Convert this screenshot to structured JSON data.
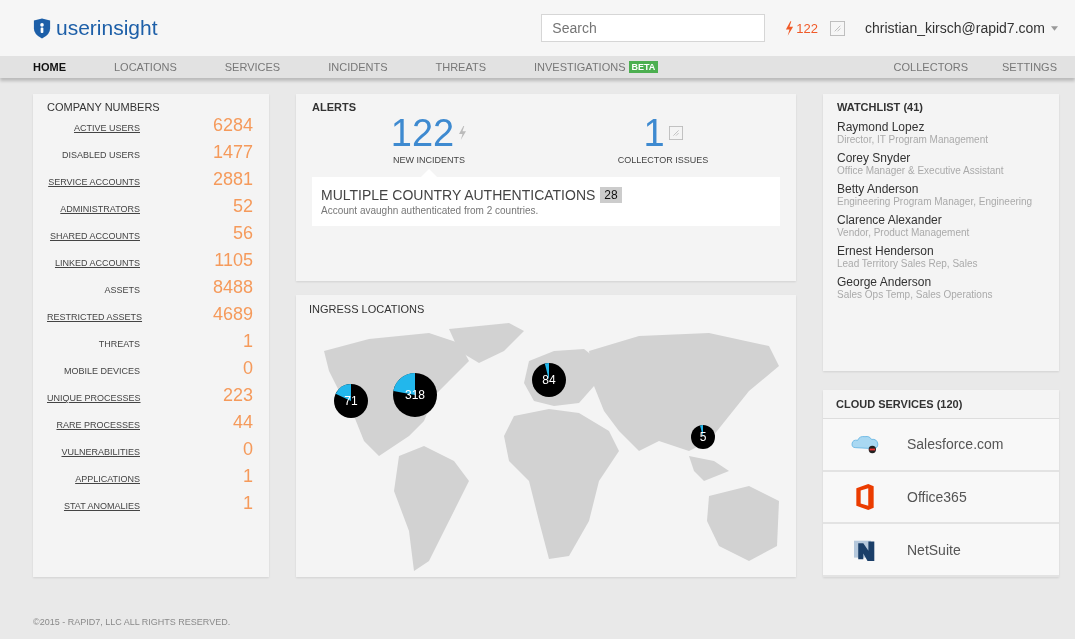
{
  "header": {
    "logo": "**user**insight",
    "search": {
      "placeholder": "Search"
    },
    "incident_count": "122",
    "user": "christian_kirsch@rapid7.com"
  },
  "nav": {
    "left": [
      {
        "label": "HOME",
        "selected": true
      },
      {
        "label": "LOCATIONS",
        "selected": false
      },
      {
        "label": "SERVICES",
        "selected": false
      },
      {
        "label": "INCIDENTS",
        "selected": false
      },
      {
        "label": "THREATS",
        "selected": false
      },
      {
        "label": "INVESTIGATIONS",
        "selected": false,
        "badge": "BETA"
      }
    ],
    "right": [
      {
        "label": "COLLECTORS",
        "selected": false
      },
      {
        "label": "SETTINGS",
        "selected": false
      }
    ]
  },
  "company_numbers": {
    "title": "COMPANY NUMBERS",
    "rows": [
      {
        "label": "ACTIVE USERS",
        "value": "6284",
        "link": true
      },
      {
        "label": "DISABLED USERS",
        "value": "1477",
        "link": false
      },
      {
        "label": "SERVICE ACCOUNTS",
        "value": "2881",
        "link": true
      },
      {
        "label": "ADMINISTRATORS",
        "value": "52",
        "link": true
      },
      {
        "label": "SHARED ACCOUNTS",
        "value": "56",
        "link": true
      },
      {
        "label": "LINKED ACCOUNTS",
        "value": "1105",
        "link": true
      },
      {
        "label": "ASSETS",
        "value": "8488",
        "link": false
      },
      {
        "label": "RESTRICTED ASSETS",
        "value": "4689",
        "link": true
      },
      {
        "label": "THREATS",
        "value": "1",
        "link": false
      },
      {
        "label": "MOBILE DEVICES",
        "value": "0",
        "link": false
      },
      {
        "label": "UNIQUE PROCESSES",
        "value": "223",
        "link": true
      },
      {
        "label": "RARE PROCESSES",
        "value": "44",
        "link": true
      },
      {
        "label": "VULNERABILITIES",
        "value": "0",
        "link": true
      },
      {
        "label": "APPLICATIONS",
        "value": "1",
        "link": true
      },
      {
        "label": "STAT ANOMALIES",
        "value": "1",
        "link": true
      }
    ]
  },
  "alerts": {
    "title": "ALERTS",
    "stats": [
      {
        "value": "122",
        "label": "NEW INCIDENTS",
        "selected": true,
        "kind": "incidents"
      },
      {
        "value": "1",
        "label": "COLLECTOR ISSUES",
        "selected": false,
        "kind": "collectors"
      }
    ],
    "detail": {
      "title": "MULTIPLE COUNTRY AUTHENTICATIONS",
      "count": "28",
      "text": "Account avaughn authenticated from 2 countries."
    }
  },
  "ingress_locations": {
    "title": "INGRESS LOCATIONS",
    "markers": [
      {
        "count": "71"
      },
      {
        "count": "318"
      },
      {
        "count": "84"
      },
      {
        "count": "5"
      }
    ]
  },
  "watchlist": {
    "title": "WATCHLIST (41)",
    "people": [
      {
        "name": "Raymond Lopez",
        "role": "Director, IT Program Management"
      },
      {
        "name": "Corey Snyder",
        "role": "Office Manager & Executive Assistant"
      },
      {
        "name": "Betty Anderson",
        "role": "Engineering Program Manager, Engineering"
      },
      {
        "name": "Clarence Alexander",
        "role": "Vendor, Product Management"
      },
      {
        "name": "Ernest Henderson",
        "role": "Lead Territory Sales Rep, Sales"
      },
      {
        "name": "George Anderson",
        "role": "Sales Ops Temp, Sales Operations"
      }
    ]
  },
  "cloud_services": {
    "title": "CLOUD SERVICES (120)",
    "services": [
      {
        "name": "Salesforce.com",
        "kind": "cloud"
      },
      {
        "name": "Office365",
        "kind": "office"
      },
      {
        "name": "NetSuite",
        "kind": "netsuite"
      }
    ]
  },
  "footer": "©2015 - RAPID7, LLC ALL RIGHTS RESERVED."
}
